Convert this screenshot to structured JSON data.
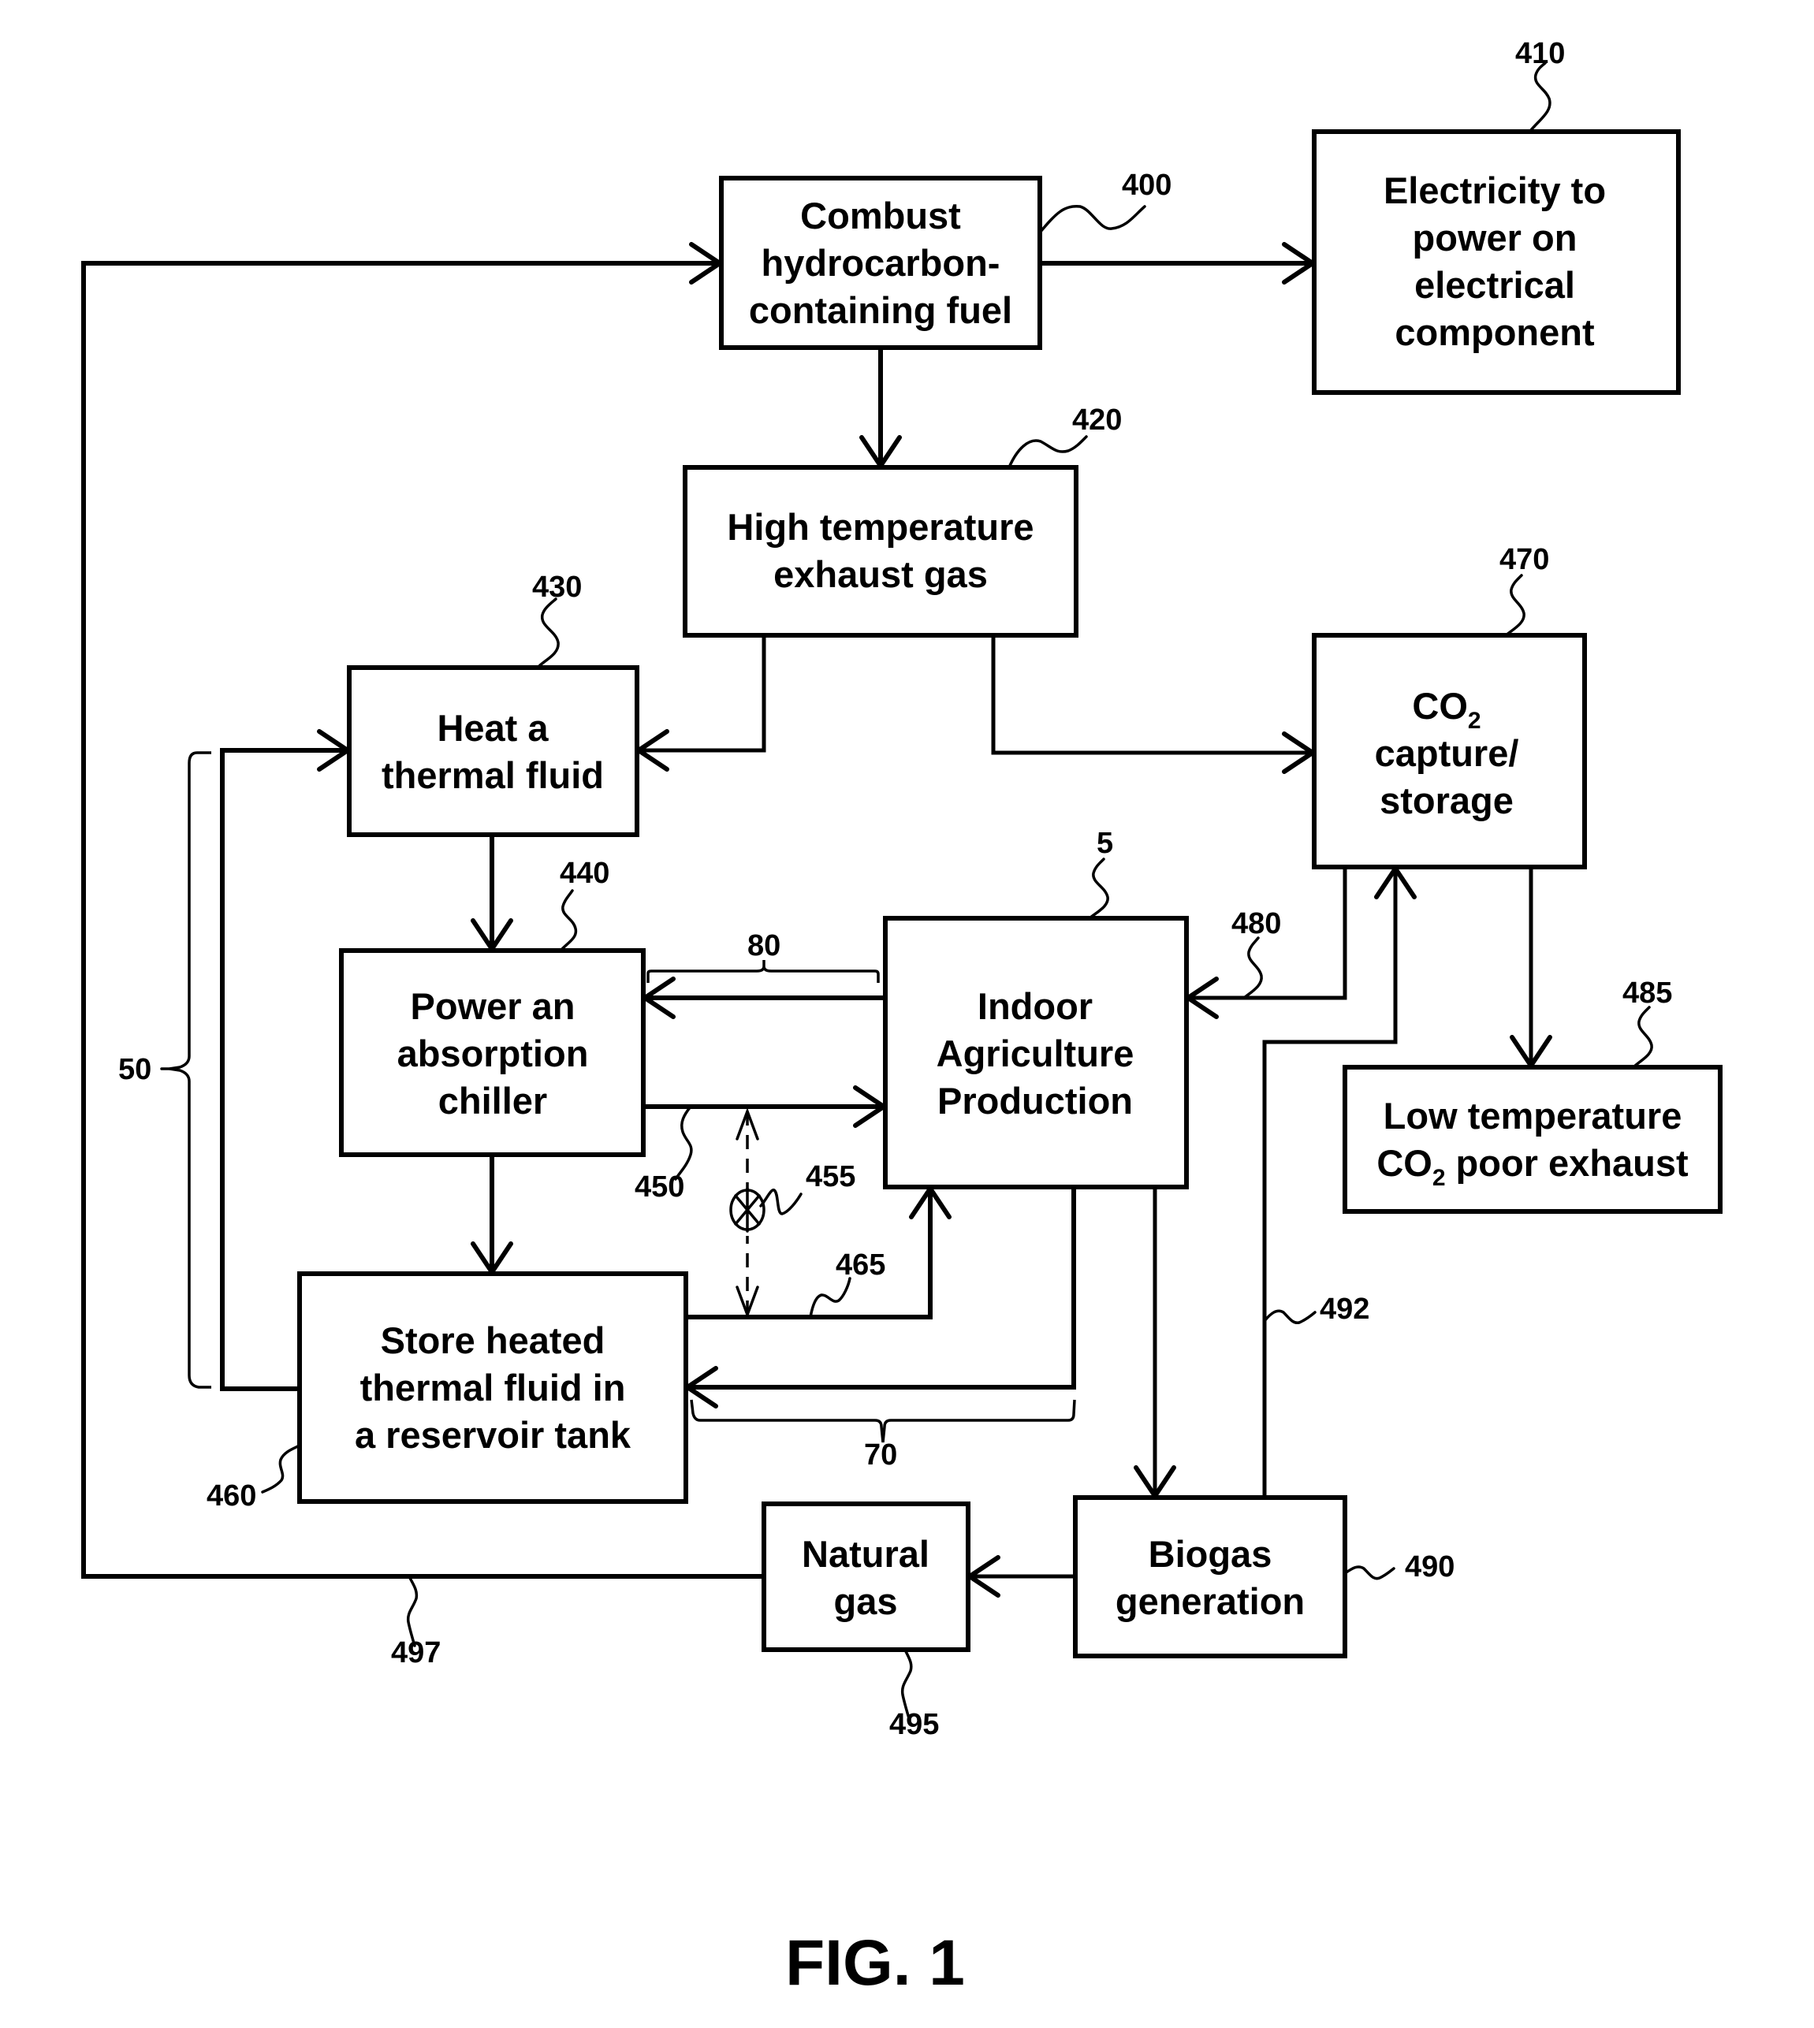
{
  "figure": {
    "caption": "FIG. 1",
    "colors": {
      "ink": "#000000",
      "background": "#ffffff"
    }
  },
  "boxes": {
    "combust": {
      "ref": "400",
      "lines": [
        "Combust",
        "hydrocarbon-",
        "containing fuel"
      ]
    },
    "electricity": {
      "ref": "410",
      "lines": [
        "Electricity to",
        "power on",
        "electrical",
        "component"
      ]
    },
    "exhaust": {
      "ref": "420",
      "lines": [
        "High temperature",
        "exhaust gas"
      ]
    },
    "heat": {
      "ref": "430",
      "lines": [
        "Heat a",
        "thermal fluid"
      ]
    },
    "chiller": {
      "ref": "440",
      "lines": [
        "Power an",
        "absorption",
        "chiller"
      ]
    },
    "store": {
      "ref": "460",
      "lines": [
        "Store heated",
        "thermal fluid in",
        "a reservoir tank"
      ]
    },
    "co2": {
      "ref": "470",
      "line1_main": "CO",
      "line1_sub": "2",
      "lines": [
        "capture/",
        "storage"
      ]
    },
    "indoor": {
      "ref": "5",
      "lines": [
        "Indoor",
        "Agriculture",
        "Production"
      ]
    },
    "lowtemp": {
      "ref": "485",
      "line1": "Low temperature",
      "line2_main": "CO",
      "line2_sub": "2",
      "line2_rest": " poor exhaust"
    },
    "biogas": {
      "ref": "490",
      "lines": [
        "Biogas",
        "generation"
      ]
    },
    "natgas": {
      "ref": "495",
      "lines": [
        "Natural",
        "gas"
      ]
    }
  },
  "refs": {
    "flow_450": "450",
    "valve_455": "455",
    "flow_465": "465",
    "flow_480": "480",
    "flow_492": "492",
    "flow_497": "497",
    "loop_50": "50",
    "loop_70": "70",
    "loop_80": "80"
  },
  "symbols": {
    "valve": "valve-icon"
  }
}
